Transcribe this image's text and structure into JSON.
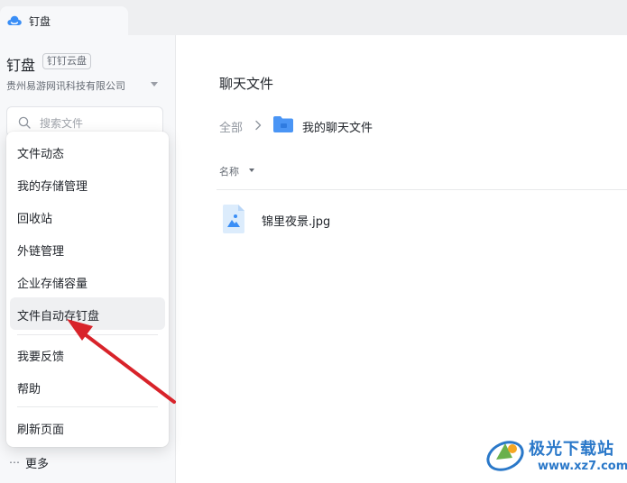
{
  "tab": {
    "title": "钉盘",
    "icon": "dingpan-cloud-icon"
  },
  "sidebar": {
    "app_title": "钉盘",
    "app_badge": "钉钉云盘",
    "org_name": "贵州易游网讯科技有限公司",
    "search_placeholder": "搜索文件",
    "more_label": "更多"
  },
  "menu": {
    "items": [
      {
        "label": "文件动态"
      },
      {
        "label": "我的存储管理"
      },
      {
        "label": "回收站"
      },
      {
        "label": "外链管理"
      },
      {
        "label": "企业存储容量"
      },
      {
        "label": "文件自动存钉盘",
        "active": true
      },
      {
        "label": "我要反馈"
      },
      {
        "label": "帮助"
      },
      {
        "label": "刷新页面"
      }
    ]
  },
  "main": {
    "title": "聊天文件",
    "breadcrumb": {
      "root": "全部",
      "current": "我的聊天文件"
    },
    "column_name": "名称",
    "files": [
      {
        "name": "锦里夜景.jpg",
        "icon": "image-file-icon"
      }
    ]
  },
  "watermark": {
    "title": "极光下载站",
    "url": "www.xz7.com"
  },
  "colors": {
    "accent": "#3a8ef6",
    "annotation_arrow": "#d8232a",
    "watermark": "#2a78c9"
  }
}
